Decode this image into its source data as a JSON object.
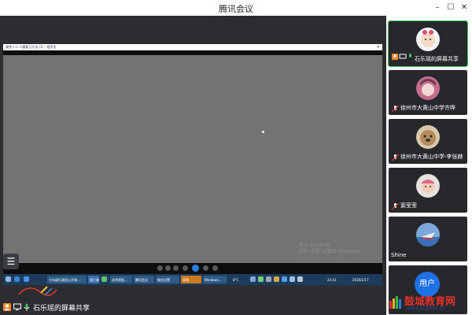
{
  "app": {
    "title": "腾讯会议"
  },
  "window_controls": [
    "minimize-icon",
    "maximize-icon",
    "close-icon"
  ],
  "shared_window": {
    "title": "课堂十二 二模复习方法 (1) - 程序员",
    "watermark_line1": "激活 Windows",
    "watermark_line2": "转到\"设置\"以激活 Windows。",
    "taskbar_items": [
      "七年级行政班公开课...",
      "第六课时",
      "北师视角...",
      "腾讯会议",
      "微信设置",
      "表格",
      "Windows..."
    ],
    "clock": "23:43",
    "date": "2020/2/17",
    "weather": "8°C"
  },
  "presenter": {
    "label": "石乐瑶的屏幕共享"
  },
  "participants": [
    {
      "name": "石乐瑶的屏幕共享",
      "active": true,
      "avatar": "baby-avatar"
    },
    {
      "name": "徐州市大黄山中学齐晔",
      "active": false,
      "avatar": "anime-girl-avatar"
    },
    {
      "name": "徐州市大黄山中学-李张赫",
      "active": false,
      "avatar": "dog-avatar"
    },
    {
      "name": "窦莹莹",
      "active": false,
      "avatar": "child-avatar"
    },
    {
      "name": "Shine",
      "active": false,
      "avatar": "boat-avatar"
    },
    {
      "name": "",
      "active": false,
      "avatar": "user-avatar",
      "avatar_text": "用户"
    }
  ],
  "logo": {
    "text": "鼓城教育网",
    "url": "www.pcjyedu.cn"
  },
  "colors": {
    "accent": "#3ec15a",
    "user_blue": "#1f6fe5",
    "stage": "#2b2d31"
  }
}
